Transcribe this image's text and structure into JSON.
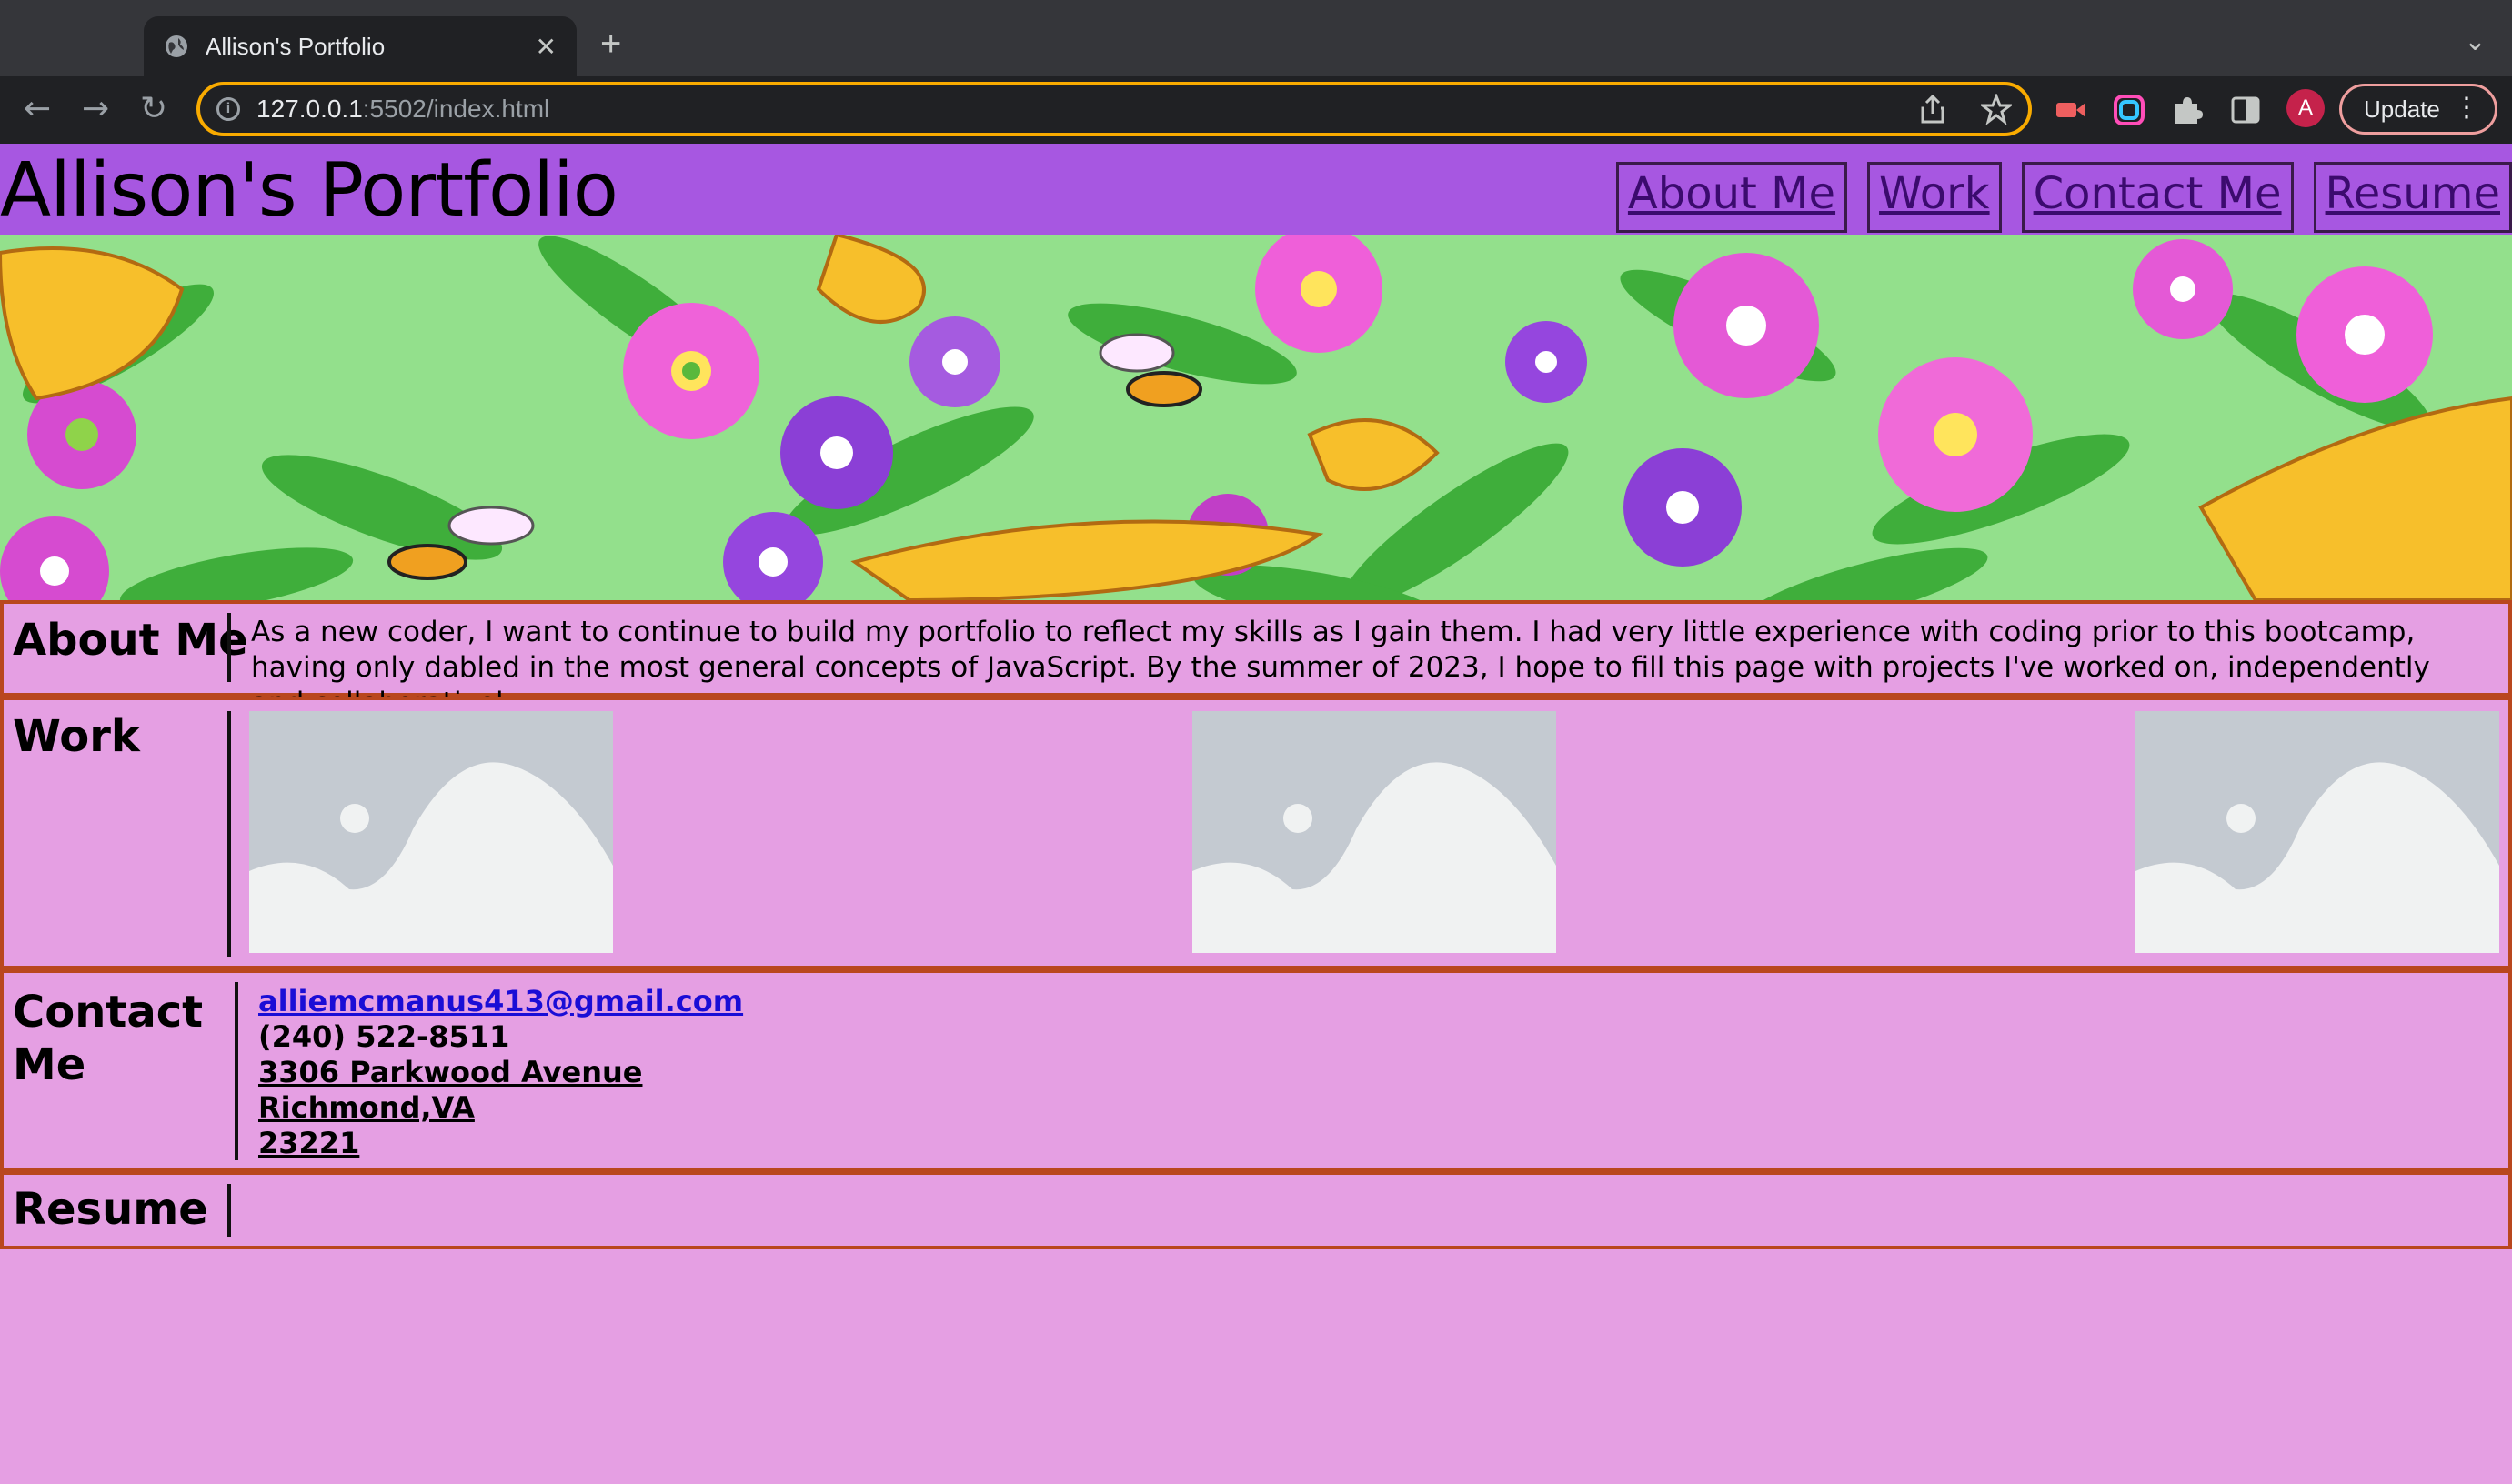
{
  "browser": {
    "tab_title": "Allison's Portfolio",
    "tab_close": "✕",
    "new_tab": "+",
    "tab_menu": "⌄",
    "url_host": "127.0.0.1",
    "url_rest": ":5502/index.html",
    "back": "←",
    "forward": "→",
    "reload": "↻",
    "info": "i",
    "profile_initial": "A",
    "update_label": "Update",
    "menu_dots": "⋮"
  },
  "header": {
    "title": "Allison's Portfolio",
    "nav": [
      "About Me",
      "Work",
      "Contact Me",
      "Resume"
    ]
  },
  "about": {
    "heading": "About Me",
    "text": "As a new coder, I want to continue to build my portfolio to reflect my skills as I gain them. I had very little experience with coding prior to this bootcamp, having only dabled in the most general concepts of JavaScript. By the summer of 2023, I hope to fill this page with projects I've worked on, independently and collaboratively."
  },
  "work": {
    "heading": "Work",
    "images": [
      "image-placeholder",
      "image-placeholder",
      "image-placeholder"
    ]
  },
  "contact": {
    "heading_line1": "Contact",
    "heading_line2": "Me",
    "email": "alliemcmanus413@gmail.com",
    "phone": "(240) 522-8511",
    "street": "3306 Parkwood Avenue",
    "city": "Richmond,VA",
    "zip": "23221"
  },
  "resume": {
    "heading": "Resume"
  },
  "colors": {
    "header_bg": "#a757e1",
    "page_bg": "#e59fe3",
    "section_border": "#b9471e",
    "link": "#1a0dd6"
  }
}
